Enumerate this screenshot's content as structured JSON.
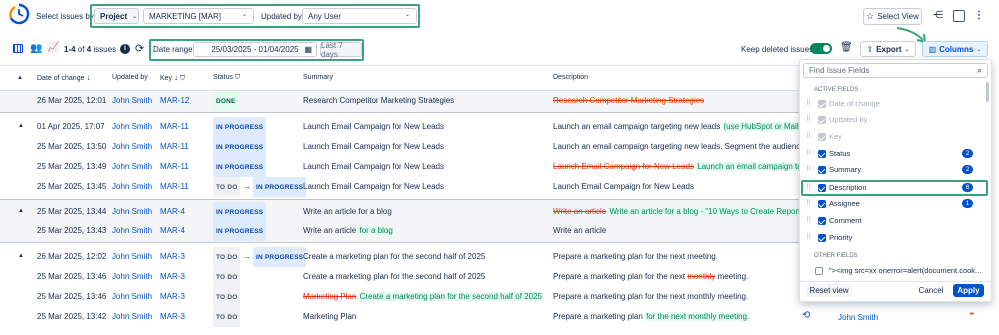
{
  "toolbar": {
    "select_issues_label": "Select issues by:",
    "scope_select": "Project",
    "project_select": "MARKETING [MAR]",
    "updated_by_label": "Updated by:",
    "updated_by_select": "Any User",
    "select_view_label": "Select View"
  },
  "summary": {
    "range_text": "1-4",
    "of_text": "of",
    "total": "4",
    "unit": "issues",
    "date_range_label": "Date range:",
    "date_range_value": "25/03/2025 - 01/04/2025",
    "last_7_days": "Last 7 days",
    "keep_deleted_label": "Keep deleted issues",
    "export_label": "Export",
    "columns_label": "Columns"
  },
  "columns": {
    "date": "Date of change",
    "updated_by": "Updated by",
    "key": "Key",
    "status": "Status",
    "summary": "Summary",
    "description": "Description"
  },
  "rows": [
    {
      "date": "26 Mar 2025, 12:01",
      "user": "John Smith",
      "key": "MAR-12",
      "status": "DONE",
      "summary": "Research Competitor Marketing Strategies",
      "desc_strike": "Research Competitor Marketing Strategies"
    },
    {
      "date": "01 Apr 2025, 17:07",
      "user": "John Smith",
      "key": "MAR-11",
      "status": "IN PROGRESS",
      "summary": "Launch Email Campaign for New Leads",
      "desc": "Launch an email campaign targeting new leads",
      "desc_add": "(use HubSpot or Mailchi..."
    },
    {
      "date": "25 Mar 2025, 13:50",
      "user": "John Smith",
      "key": "MAR-11",
      "status": "IN PROGRESS",
      "summary": "Launch Email Campaign for New Leads",
      "desc": "Launch an email campaign targeting new leads. Segment the audience fo..."
    },
    {
      "date": "25 Mar 2025, 13:49",
      "user": "John Smith",
      "key": "MAR-11",
      "status": "IN PROGRESS",
      "summary": "Launch Email Campaign for New Leads",
      "desc_strike": "Launch Email Campaign for New Leads",
      "desc_add": "Launch an email campaign targ..."
    },
    {
      "date": "25 Mar 2025, 13:45",
      "user": "John Smith",
      "key": "MAR-11",
      "status_from": "TO DO",
      "status": "IN PROGRESS",
      "summary": "Launch Email Campaign for New Leads",
      "desc": "Launch Email Campaign for New Leads"
    },
    {
      "date": "25 Mar 2025, 13:44",
      "user": "John Smith",
      "key": "MAR-4",
      "status": "IN PROGRESS",
      "summary": "Write an article for a blog",
      "desc_strike": "Write an article",
      "desc_add": "Write an article for a blog - \"10 Ways to Create Reports E..."
    },
    {
      "date": "25 Mar 2025, 13:43",
      "user": "John Smith",
      "key": "MAR-4",
      "status": "IN PROGRESS",
      "summary": "Write an article",
      "summary_add": "for a blog",
      "desc": "Write an article"
    },
    {
      "date": "26 Mar 2025, 12:02",
      "user": "John Smith",
      "key": "MAR-3",
      "status_from": "TO DO",
      "status": "IN PROGRESS",
      "summary": "Create a marketing plan for the second half of 2025",
      "desc": "Prepare a marketing plan for the next meeting."
    },
    {
      "date": "25 Mar 2025, 13:46",
      "user": "John Smith",
      "key": "MAR-3",
      "status": "TO DO",
      "summary": "Create a marketing plan for the second half of 2025",
      "desc": "Prepare a marketing plan for the next",
      "desc_strike2": "monthly",
      "desc_tail": "meeting."
    },
    {
      "date": "25 Mar 2025, 13:46",
      "user": "John Smith",
      "key": "MAR-3",
      "status": "TO DO",
      "summary_strike": "Marketing Plan",
      "summary_add": "Create a marketing plan for the second half of 2025",
      "desc": "Prepare a marketing plan for the next monthly meeting."
    },
    {
      "date": "25 Mar 2025, 13:42",
      "user": "John Smith",
      "key": "MAR-3",
      "status": "TO DO",
      "summary": "Marketing Plan",
      "desc": "Prepare a marketing plan",
      "desc_add": "for the next monthly meeting."
    }
  ],
  "trailing": {
    "assignee": "John Smith"
  },
  "panel": {
    "search_placeholder": "Find Issue Fields",
    "active_fields_label": "ACTIVE FIELDS",
    "active_fields": [
      {
        "label": "Date of change",
        "state": "disabled"
      },
      {
        "label": "Updated by",
        "state": "disabled"
      },
      {
        "label": "Key",
        "state": "disabled"
      },
      {
        "label": "Status",
        "state": "checked",
        "count": "2"
      },
      {
        "label": "Summary",
        "state": "checked",
        "count": "2"
      },
      {
        "label": "Description",
        "state": "checked",
        "count": "6"
      },
      {
        "label": "Assignee",
        "state": "checked",
        "count": "1"
      },
      {
        "label": "Comment",
        "state": "checked"
      },
      {
        "label": "Priority",
        "state": "checked"
      }
    ],
    "other_fields_label": "OTHER FIELDS",
    "other_field": "\"><img src=xx onerror=alert(document.cook...",
    "reset_label": "Reset view",
    "cancel_label": "Cancel",
    "apply_label": "Apply"
  },
  "colors": {
    "accent": "#0052cc",
    "highlight": "#3aa57a",
    "toggle": "#00875a",
    "priority": "#de350b"
  }
}
